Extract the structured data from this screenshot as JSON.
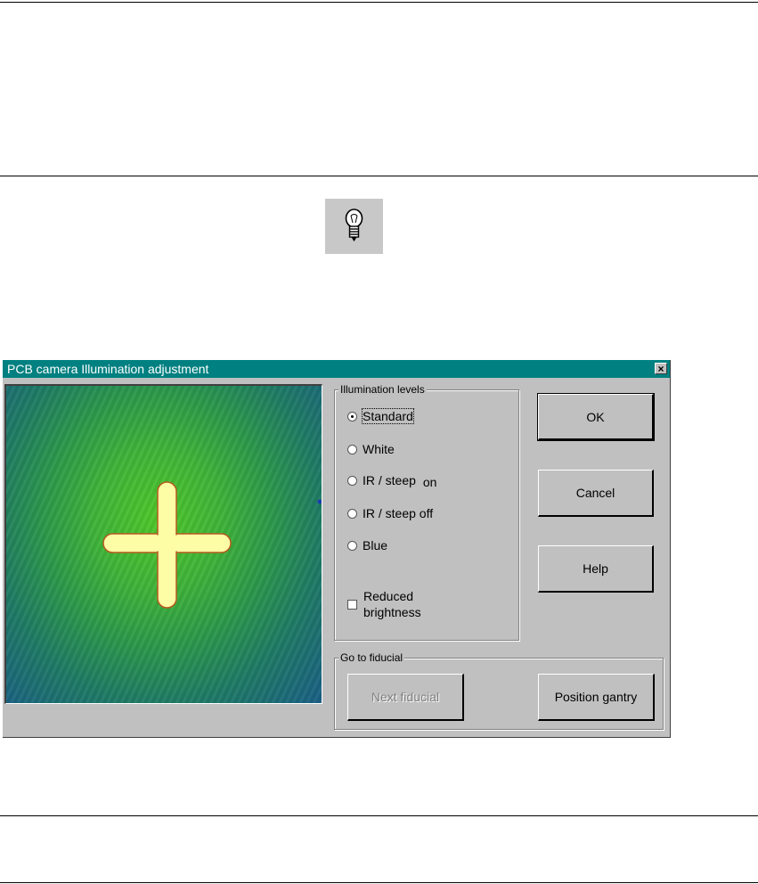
{
  "dialog": {
    "title": "PCB camera Illumination adjustment",
    "close_glyph": "×"
  },
  "illumination": {
    "group_label": "Illumination levels",
    "options": [
      {
        "label": "Standard",
        "checked": true
      },
      {
        "label": "White",
        "checked": false
      },
      {
        "label": "IR / steep",
        "suffix": "on",
        "checked": false
      },
      {
        "label": "IR / steep off",
        "checked": false
      },
      {
        "label": "Blue",
        "checked": false
      }
    ],
    "reduced_line1": "Reduced",
    "reduced_line2": "brightness",
    "reduced_checked": false
  },
  "buttons": {
    "ok": "OK",
    "cancel": "Cancel",
    "help": "Help"
  },
  "fiducial": {
    "group_label": "Go to fiducial",
    "next": "Next fiducial",
    "position": "Position gantry"
  },
  "icons": {
    "page_icon": "light-bulb-icon",
    "close": "close-icon"
  },
  "colors": {
    "titlebar": "#008080",
    "dialog_bg": "#c0c0c0",
    "fiducial_fill": "#fdfda6"
  }
}
